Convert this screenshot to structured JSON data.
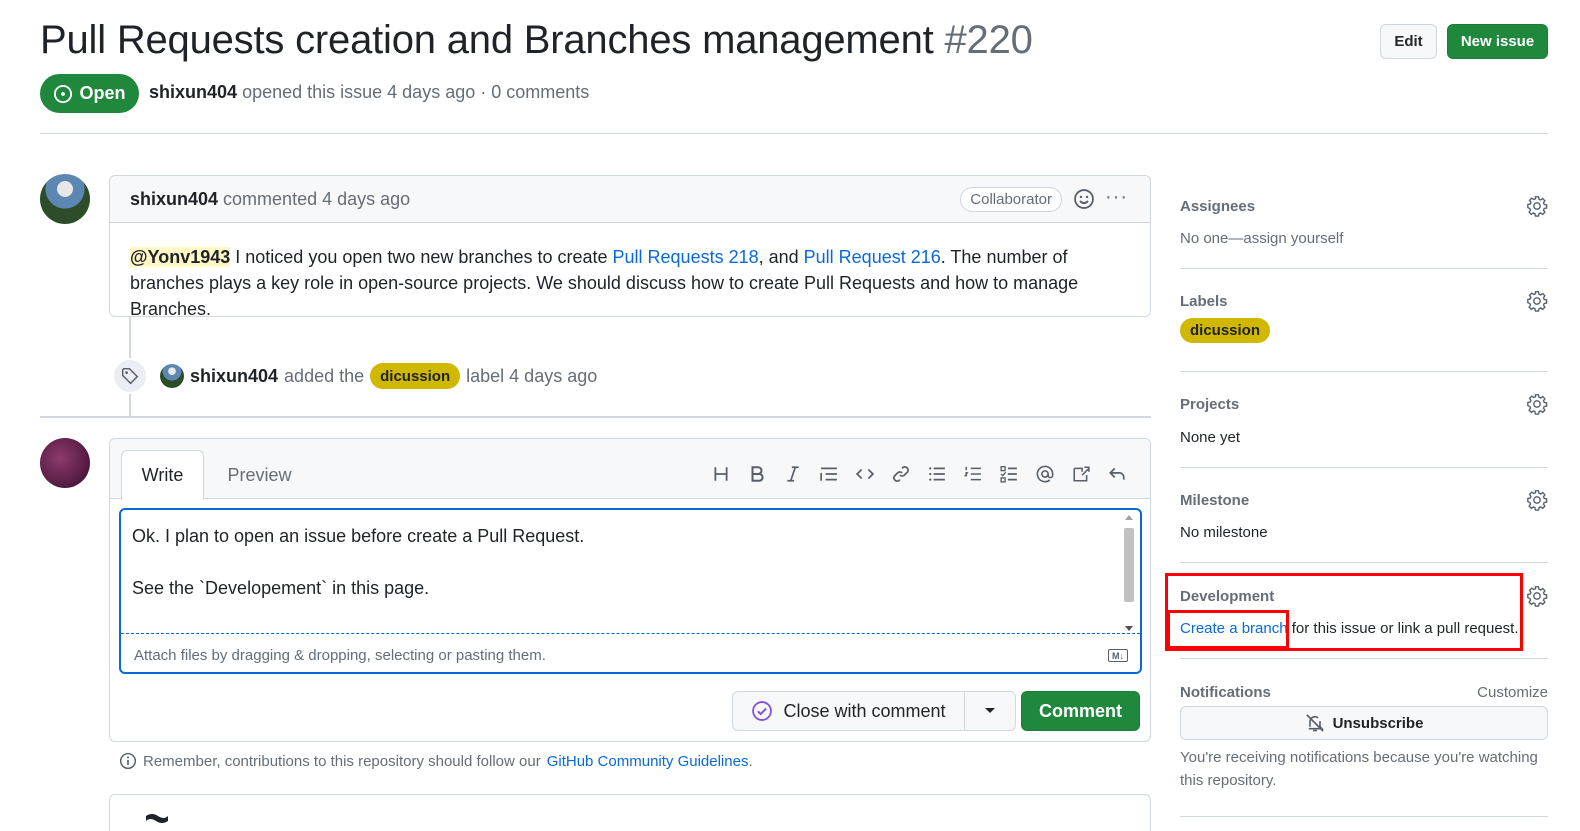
{
  "header": {
    "title": "Pull Requests creation and Branches management",
    "number": "#220",
    "edit_label": "Edit",
    "new_issue_label": "New issue",
    "state": "Open",
    "author": "shixun404",
    "meta_text": "opened this issue 4 days ago · 0 comments"
  },
  "comment": {
    "author": "shixun404",
    "time": "commented 4 days ago",
    "badge": "Collaborator",
    "more": "···",
    "mention": "@Yonv1943",
    "body_1": " I noticed you open two new branches to create ",
    "link_1": "Pull Requests 218",
    "body_2": ", and ",
    "link_2": "Pull Request 216",
    "body_3": ". The number of branches plays a key role in open-source projects. We should discuss how to create Pull Requests and how to manage Branches."
  },
  "event": {
    "author": "shixun404",
    "pre": "added the",
    "label": "dicussion",
    "post": "label 4 days ago"
  },
  "composer": {
    "tab_write": "Write",
    "tab_preview": "Preview",
    "text": "Ok. I plan to open an issue before create a Pull Request.\n\nSee the `Developement` in this page.",
    "attach_hint": "Attach files by dragging & dropping, selecting or pasting them.",
    "md_badge": "M↓",
    "close_label": "Close with comment",
    "comment_label": "Comment"
  },
  "footer": {
    "remember_text": "Remember, contributions to this repository should follow our",
    "guidelines_link": "GitHub Community Guidelines",
    "period": "."
  },
  "sidebar": {
    "assignees_title": "Assignees",
    "assignees_value": "No one—assign yourself",
    "labels_title": "Labels",
    "labels_value": "dicussion",
    "projects_title": "Projects",
    "projects_value": "None yet",
    "milestone_title": "Milestone",
    "milestone_value": "No milestone",
    "development_title": "Development",
    "development_link": "Create a branch",
    "development_rest": " for this issue or link a pull request.",
    "notifications_title": "Notifications",
    "customize": "Customize",
    "unsubscribe": "Unsubscribe",
    "notif_text": "You're receiving notifications because you're watching this repository."
  },
  "colors": {
    "green": "#1f883d",
    "link": "#0969da",
    "label": "#d0b800",
    "annotation": "#ff0000"
  }
}
